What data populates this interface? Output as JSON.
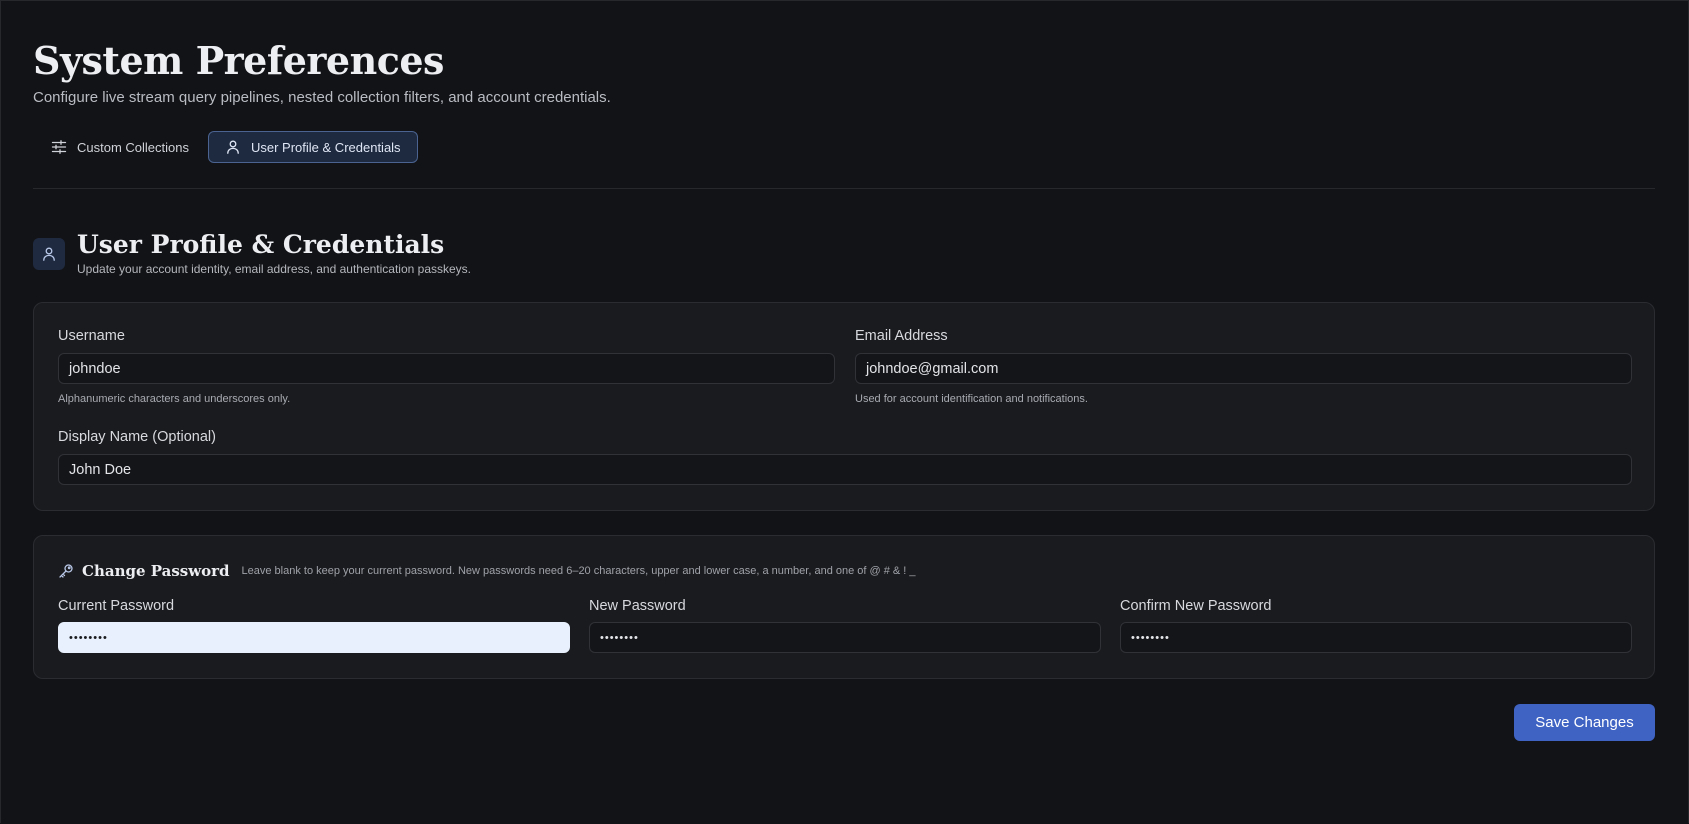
{
  "header": {
    "title": "System Preferences",
    "subtitle": "Configure live stream query pipelines, nested collection filters, and account credentials."
  },
  "tabs": [
    {
      "label": "Custom Collections",
      "icon": "sliders-icon",
      "active": false
    },
    {
      "label": "User Profile & Credentials",
      "icon": "user-icon",
      "active": true
    }
  ],
  "section": {
    "icon": "user-icon",
    "title": "User Profile & Credentials",
    "description": "Update your account identity, email address, and authentication passkeys."
  },
  "profile": {
    "username": {
      "label": "Username",
      "value": "johndoe",
      "hint": "Alphanumeric characters and underscores only."
    },
    "email": {
      "label": "Email Address",
      "value": "johndoe@gmail.com",
      "hint": "Used for account identification and notifications."
    },
    "display_name": {
      "label": "Display Name (Optional)",
      "value": "John Doe"
    }
  },
  "password": {
    "icon": "key-icon",
    "title": "Change Password",
    "note": "Leave blank to keep your current password. New passwords need 6–20 characters, upper and lower case, a number, and one of @ # & ! _",
    "current": {
      "label": "Current Password",
      "value": "••••••••"
    },
    "new": {
      "label": "New Password",
      "value": "••••••••"
    },
    "confirm": {
      "label": "Confirm New Password",
      "value": "••••••••"
    }
  },
  "actions": {
    "save_label": "Save Changes"
  },
  "colors": {
    "background": "#121316",
    "card": "#1a1b1e",
    "accent": "#3f63c3",
    "active_tab": "#1e2a3f",
    "focused_input": "#e7f0fc"
  }
}
